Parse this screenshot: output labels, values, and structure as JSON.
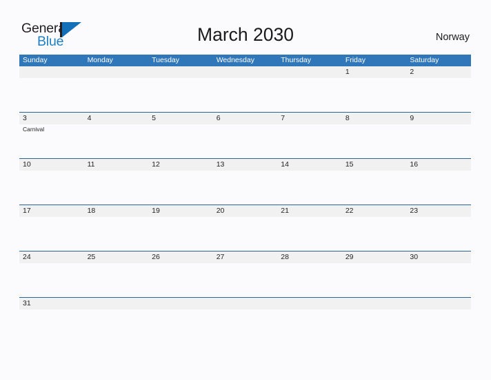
{
  "brand": {
    "name_part1": "General",
    "name_part2": "Blue",
    "bar_icon": "logo-bar-icon",
    "triangle_icon": "logo-triangle-icon"
  },
  "header": {
    "title": "March 2030",
    "country": "Norway"
  },
  "colors": {
    "header_blue": "#2f77b8",
    "separator_blue": "#2a6496",
    "date_band_gray": "#f1f1f1",
    "brand_blue": "#1170b8",
    "page_background": "#fbfbfd"
  },
  "calendar": {
    "weekdays": [
      "Sunday",
      "Monday",
      "Tuesday",
      "Wednesday",
      "Thursday",
      "Friday",
      "Saturday"
    ],
    "weeks": [
      {
        "days": [
          {
            "date": "",
            "events": []
          },
          {
            "date": "",
            "events": []
          },
          {
            "date": "",
            "events": []
          },
          {
            "date": "",
            "events": []
          },
          {
            "date": "",
            "events": []
          },
          {
            "date": "1",
            "events": []
          },
          {
            "date": "2",
            "events": []
          }
        ]
      },
      {
        "days": [
          {
            "date": "3",
            "events": [
              "Carnival"
            ]
          },
          {
            "date": "4",
            "events": []
          },
          {
            "date": "5",
            "events": []
          },
          {
            "date": "6",
            "events": []
          },
          {
            "date": "7",
            "events": []
          },
          {
            "date": "8",
            "events": []
          },
          {
            "date": "9",
            "events": []
          }
        ]
      },
      {
        "days": [
          {
            "date": "10",
            "events": []
          },
          {
            "date": "11",
            "events": []
          },
          {
            "date": "12",
            "events": []
          },
          {
            "date": "13",
            "events": []
          },
          {
            "date": "14",
            "events": []
          },
          {
            "date": "15",
            "events": []
          },
          {
            "date": "16",
            "events": []
          }
        ]
      },
      {
        "days": [
          {
            "date": "17",
            "events": []
          },
          {
            "date": "18",
            "events": []
          },
          {
            "date": "19",
            "events": []
          },
          {
            "date": "20",
            "events": []
          },
          {
            "date": "21",
            "events": []
          },
          {
            "date": "22",
            "events": []
          },
          {
            "date": "23",
            "events": []
          }
        ]
      },
      {
        "days": [
          {
            "date": "24",
            "events": []
          },
          {
            "date": "25",
            "events": []
          },
          {
            "date": "26",
            "events": []
          },
          {
            "date": "27",
            "events": []
          },
          {
            "date": "28",
            "events": []
          },
          {
            "date": "29",
            "events": []
          },
          {
            "date": "30",
            "events": []
          }
        ]
      },
      {
        "days": [
          {
            "date": "31",
            "events": []
          },
          {
            "date": "",
            "events": []
          },
          {
            "date": "",
            "events": []
          },
          {
            "date": "",
            "events": []
          },
          {
            "date": "",
            "events": []
          },
          {
            "date": "",
            "events": []
          },
          {
            "date": "",
            "events": []
          }
        ]
      }
    ]
  }
}
